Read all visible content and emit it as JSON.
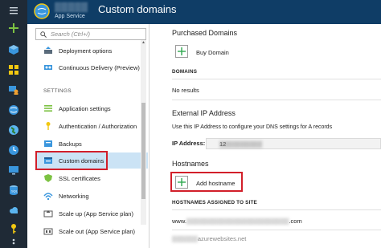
{
  "header": {
    "resource_name": "▒▒▒▒▒",
    "title": "Custom domains",
    "subtitle": "App Service"
  },
  "rail_icons": [
    "menu-icon",
    "plus-icon",
    "cube-icon",
    "grid-icon",
    "person-monitor-icon",
    "globe-icon",
    "world-icon",
    "clock-icon",
    "monitor-icon",
    "sql-icon",
    "cloud-icon",
    "key-icon",
    "dots-icon"
  ],
  "menu": {
    "search_placeholder": "Search (Ctrl+/)",
    "items_top": [
      {
        "label": "Deployment options",
        "icon": "deploy-icon"
      },
      {
        "label": "Continuous Delivery (Preview)",
        "icon": "delivery-icon"
      }
    ],
    "section_settings": "SETTINGS",
    "items_settings": [
      {
        "label": "Application settings",
        "icon": "settings-list-icon"
      },
      {
        "label": "Authentication / Authorization",
        "icon": "key-icon"
      },
      {
        "label": "Backups",
        "icon": "backup-icon"
      },
      {
        "label": "Custom domains",
        "icon": "domain-icon"
      },
      {
        "label": "SSL certificates",
        "icon": "shield-icon"
      },
      {
        "label": "Networking",
        "icon": "network-icon"
      },
      {
        "label": "Scale up (App Service plan)",
        "icon": "scale-up-icon"
      },
      {
        "label": "Scale out (App Service plan)",
        "icon": "scale-out-icon"
      }
    ]
  },
  "purchased": {
    "heading": "Purchased Domains",
    "button": "Buy Domain",
    "col_header": "DOMAINS",
    "empty": "No results"
  },
  "external_ip": {
    "heading": "External IP Address",
    "description": "Use this IP Address to configure your DNS settings for A records",
    "label": "IP Address:",
    "value_suffix": "12"
  },
  "hostnames": {
    "heading": "Hostnames",
    "button": "Add hostname",
    "col_header": "HOSTNAMES ASSIGNED TO SITE",
    "rows": [
      {
        "prefix": "www.",
        "suffix": ".com"
      },
      {
        "prefix": "",
        "suffix": "azurewebsites.net"
      }
    ]
  },
  "colors": {
    "header_bg": "#0f3d66",
    "rail_bg": "#1f2a36",
    "active_item": "#cbe3f5",
    "highlight_box": "#d21f2a",
    "add_icon": "#2fa84f"
  }
}
